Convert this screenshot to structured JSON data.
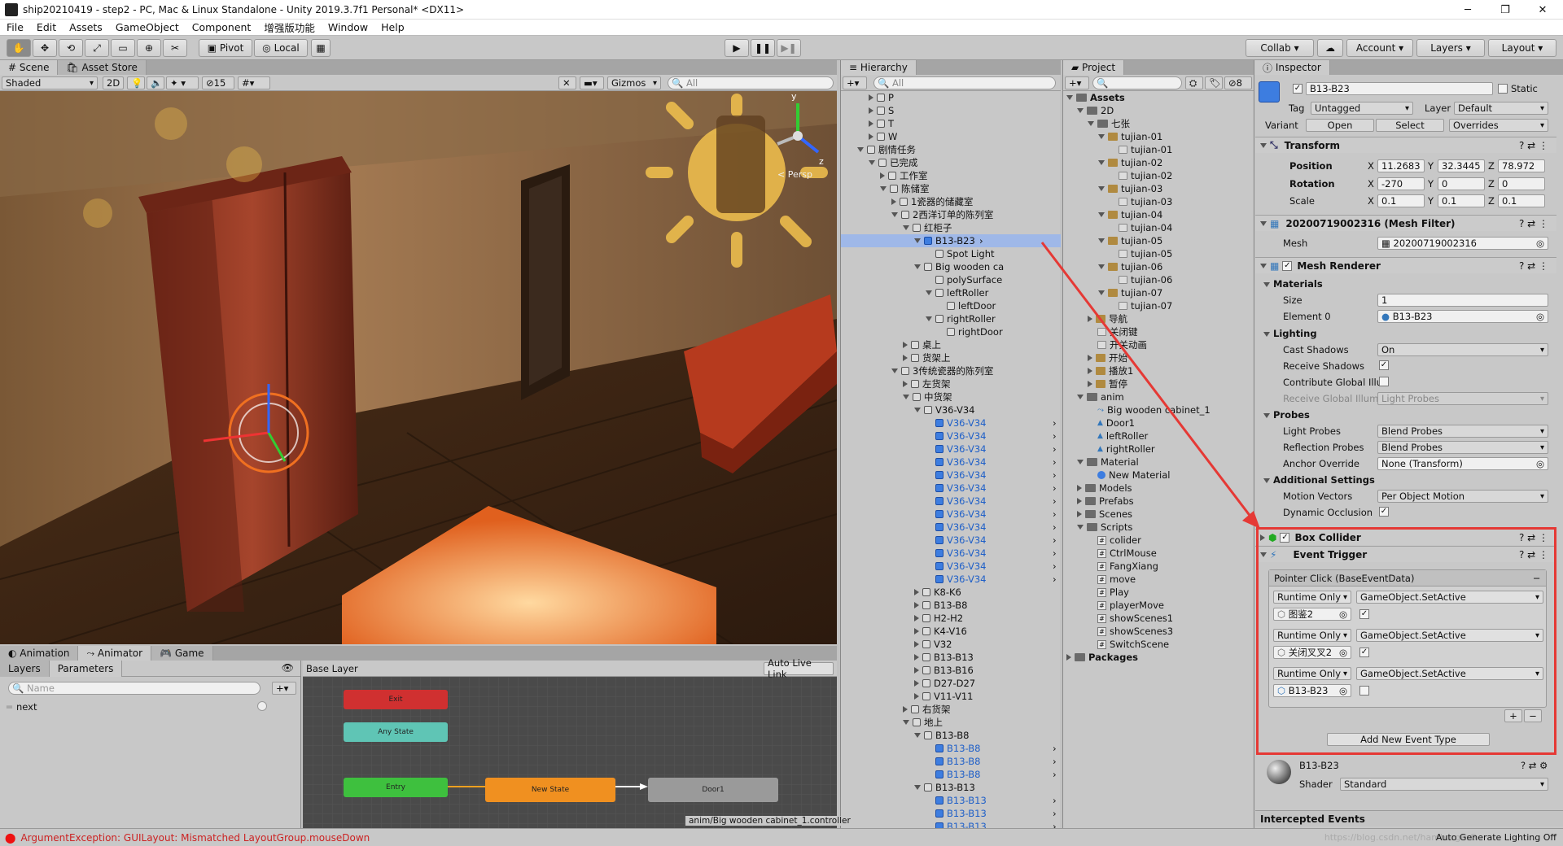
{
  "window": {
    "title": "ship20210419 - step2 - PC, Mac & Linux Standalone - Unity 2019.3.7f1 Personal* <DX11>"
  },
  "menu": [
    "File",
    "Edit",
    "Assets",
    "GameObject",
    "Component",
    "增强版功能",
    "Window",
    "Help"
  ],
  "toolbar": {
    "pivot": "Pivot",
    "local": "Local",
    "collab": "Collab",
    "account": "Account",
    "layers": "Layers",
    "layout": "Layout"
  },
  "scene": {
    "tab_scene": "Scene",
    "tab_store": "Asset Store",
    "shaded": "Shaded",
    "mode2d": "2D",
    "vis_count": "15",
    "gizmos": "Gizmos",
    "search": "All",
    "persp": "< Persp"
  },
  "hierarchy": {
    "tab": "Hierarchy",
    "search": "All",
    "items": [
      {
        "t": "P",
        "d": 6,
        "k": "r",
        "c": "g"
      },
      {
        "t": "S",
        "d": 6,
        "k": "r",
        "c": "g"
      },
      {
        "t": "T",
        "d": 6,
        "k": "r",
        "c": "g"
      },
      {
        "t": "W",
        "d": 6,
        "k": "r",
        "c": "g"
      },
      {
        "t": "剧情任务",
        "d": 5,
        "k": "d",
        "c": "g"
      },
      {
        "t": "已完成",
        "d": 6,
        "k": "d",
        "c": "g"
      },
      {
        "t": "工作室",
        "d": 7,
        "k": "r",
        "c": "g"
      },
      {
        "t": "陈储室",
        "d": 7,
        "k": "d",
        "c": "g"
      },
      {
        "t": "1瓷器的储藏室",
        "d": 8,
        "k": "r",
        "c": "g"
      },
      {
        "t": "2西洋订单的陈列室",
        "d": 8,
        "k": "d",
        "c": "g"
      },
      {
        "t": "红柜子",
        "d": 9,
        "k": "d",
        "c": "g"
      },
      {
        "t": "B13-B23",
        "d": 10,
        "k": "d",
        "c": "b",
        "sel": true
      },
      {
        "t": "Spot Light",
        "d": 11,
        "k": "n",
        "c": "g"
      },
      {
        "t": "Big wooden ca",
        "d": 10,
        "k": "d",
        "c": "g"
      },
      {
        "t": "polySurface",
        "d": 11,
        "k": "n",
        "c": "g"
      },
      {
        "t": "leftRoller",
        "d": 11,
        "k": "d",
        "c": "g"
      },
      {
        "t": "leftDoor",
        "d": 12,
        "k": "n",
        "c": "g"
      },
      {
        "t": "rightRoller",
        "d": 11,
        "k": "d",
        "c": "g"
      },
      {
        "t": "rightDoor",
        "d": 12,
        "k": "n",
        "c": "g"
      },
      {
        "t": "桌上",
        "d": 9,
        "k": "r",
        "c": "g"
      },
      {
        "t": "货架上",
        "d": 9,
        "k": "r",
        "c": "g"
      },
      {
        "t": "3传统瓷器的陈列室",
        "d": 8,
        "k": "d",
        "c": "g"
      },
      {
        "t": "左货架",
        "d": 9,
        "k": "r",
        "c": "g"
      },
      {
        "t": "中货架",
        "d": 9,
        "k": "d",
        "c": "g"
      },
      {
        "t": "V36-V34",
        "d": 10,
        "k": "d",
        "c": "g"
      },
      {
        "t": "V36-V34",
        "d": 11,
        "k": "n",
        "c": "b",
        "blue": true
      },
      {
        "t": "V36-V34",
        "d": 11,
        "k": "n",
        "c": "b",
        "blue": true
      },
      {
        "t": "V36-V34",
        "d": 11,
        "k": "n",
        "c": "b",
        "blue": true
      },
      {
        "t": "V36-V34",
        "d": 11,
        "k": "n",
        "c": "b",
        "blue": true
      },
      {
        "t": "V36-V34",
        "d": 11,
        "k": "n",
        "c": "b",
        "blue": true
      },
      {
        "t": "V36-V34",
        "d": 11,
        "k": "n",
        "c": "b",
        "blue": true
      },
      {
        "t": "V36-V34",
        "d": 11,
        "k": "n",
        "c": "b",
        "blue": true
      },
      {
        "t": "V36-V34",
        "d": 11,
        "k": "n",
        "c": "b",
        "blue": true
      },
      {
        "t": "V36-V34",
        "d": 11,
        "k": "n",
        "c": "b",
        "blue": true
      },
      {
        "t": "V36-V34",
        "d": 11,
        "k": "n",
        "c": "b",
        "blue": true
      },
      {
        "t": "V36-V34",
        "d": 11,
        "k": "n",
        "c": "b",
        "blue": true
      },
      {
        "t": "V36-V34",
        "d": 11,
        "k": "n",
        "c": "b",
        "blue": true
      },
      {
        "t": "V36-V34",
        "d": 11,
        "k": "n",
        "c": "b",
        "blue": true
      },
      {
        "t": "K8-K6",
        "d": 10,
        "k": "r",
        "c": "g"
      },
      {
        "t": "B13-B8",
        "d": 10,
        "k": "r",
        "c": "g"
      },
      {
        "t": "H2-H2",
        "d": 10,
        "k": "r",
        "c": "g"
      },
      {
        "t": "K4-V16",
        "d": 10,
        "k": "r",
        "c": "g"
      },
      {
        "t": "V32",
        "d": 10,
        "k": "r",
        "c": "g"
      },
      {
        "t": "B13-B13",
        "d": 10,
        "k": "r",
        "c": "g"
      },
      {
        "t": "B13-B16",
        "d": 10,
        "k": "r",
        "c": "g"
      },
      {
        "t": "D27-D27",
        "d": 10,
        "k": "r",
        "c": "g"
      },
      {
        "t": "V11-V11",
        "d": 10,
        "k": "r",
        "c": "g"
      },
      {
        "t": "右货架",
        "d": 9,
        "k": "r",
        "c": "g"
      },
      {
        "t": "地上",
        "d": 9,
        "k": "d",
        "c": "g"
      },
      {
        "t": "B13-B8",
        "d": 10,
        "k": "d",
        "c": "g"
      },
      {
        "t": "B13-B8",
        "d": 11,
        "k": "n",
        "c": "b",
        "blue": true
      },
      {
        "t": "B13-B8",
        "d": 11,
        "k": "n",
        "c": "b",
        "blue": true
      },
      {
        "t": "B13-B8",
        "d": 11,
        "k": "n",
        "c": "b",
        "blue": true
      },
      {
        "t": "B13-B13",
        "d": 10,
        "k": "d",
        "c": "g"
      },
      {
        "t": "B13-B13",
        "d": 11,
        "k": "n",
        "c": "b",
        "blue": true
      },
      {
        "t": "B13-B13",
        "d": 11,
        "k": "n",
        "c": "b",
        "blue": true
      },
      {
        "t": "B13-B13",
        "d": 11,
        "k": "n",
        "c": "b",
        "blue": true
      }
    ]
  },
  "project": {
    "tab": "Project",
    "count": "8",
    "items": [
      {
        "t": "Assets",
        "d": 0,
        "k": "d",
        "i": "f",
        "bold": true
      },
      {
        "t": "2D",
        "d": 1,
        "k": "d",
        "i": "f"
      },
      {
        "t": "七张",
        "d": 2,
        "k": "d",
        "i": "f"
      },
      {
        "t": "tujian-01",
        "d": 3,
        "k": "d",
        "i": "img"
      },
      {
        "t": "tujian-01",
        "d": 4,
        "k": "n",
        "i": "sp"
      },
      {
        "t": "tujian-02",
        "d": 3,
        "k": "d",
        "i": "img"
      },
      {
        "t": "tujian-02",
        "d": 4,
        "k": "n",
        "i": "sp"
      },
      {
        "t": "tujian-03",
        "d": 3,
        "k": "d",
        "i": "img"
      },
      {
        "t": "tujian-03",
        "d": 4,
        "k": "n",
        "i": "sp"
      },
      {
        "t": "tujian-04",
        "d": 3,
        "k": "d",
        "i": "img"
      },
      {
        "t": "tujian-04",
        "d": 4,
        "k": "n",
        "i": "sp"
      },
      {
        "t": "tujian-05",
        "d": 3,
        "k": "d",
        "i": "img"
      },
      {
        "t": "tujian-05",
        "d": 4,
        "k": "n",
        "i": "sp"
      },
      {
        "t": "tujian-06",
        "d": 3,
        "k": "d",
        "i": "img"
      },
      {
        "t": "tujian-06",
        "d": 4,
        "k": "n",
        "i": "sp"
      },
      {
        "t": "tujian-07",
        "d": 3,
        "k": "d",
        "i": "img"
      },
      {
        "t": "tujian-07",
        "d": 4,
        "k": "n",
        "i": "sp"
      },
      {
        "t": "导航",
        "d": 2,
        "k": "r",
        "i": "img"
      },
      {
        "t": "关闭键",
        "d": 2,
        "k": "n",
        "i": "sp"
      },
      {
        "t": "开关动画",
        "d": 2,
        "k": "n",
        "i": "sp"
      },
      {
        "t": "开始",
        "d": 2,
        "k": "r",
        "i": "img"
      },
      {
        "t": "播放1",
        "d": 2,
        "k": "r",
        "i": "img"
      },
      {
        "t": "暂停",
        "d": 2,
        "k": "r",
        "i": "img"
      },
      {
        "t": "anim",
        "d": 1,
        "k": "d",
        "i": "f"
      },
      {
        "t": "Big wooden cabinet_1",
        "d": 2,
        "k": "n",
        "i": "ctl"
      },
      {
        "t": "Door1",
        "d": 2,
        "k": "n",
        "i": "anim"
      },
      {
        "t": "leftRoller",
        "d": 2,
        "k": "n",
        "i": "anim"
      },
      {
        "t": "rightRoller",
        "d": 2,
        "k": "n",
        "i": "anim"
      },
      {
        "t": "Material",
        "d": 1,
        "k": "d",
        "i": "f"
      },
      {
        "t": "New Material",
        "d": 2,
        "k": "n",
        "i": "mat"
      },
      {
        "t": "Models",
        "d": 1,
        "k": "r",
        "i": "f"
      },
      {
        "t": "Prefabs",
        "d": 1,
        "k": "r",
        "i": "f"
      },
      {
        "t": "Scenes",
        "d": 1,
        "k": "r",
        "i": "f"
      },
      {
        "t": "Scripts",
        "d": 1,
        "k": "d",
        "i": "f"
      },
      {
        "t": "colider",
        "d": 2,
        "k": "n",
        "i": "cs"
      },
      {
        "t": "CtrlMouse",
        "d": 2,
        "k": "n",
        "i": "cs"
      },
      {
        "t": "FangXiang",
        "d": 2,
        "k": "n",
        "i": "cs"
      },
      {
        "t": "move",
        "d": 2,
        "k": "n",
        "i": "cs"
      },
      {
        "t": "Play",
        "d": 2,
        "k": "n",
        "i": "cs"
      },
      {
        "t": "playerMove",
        "d": 2,
        "k": "n",
        "i": "cs"
      },
      {
        "t": "showScenes1",
        "d": 2,
        "k": "n",
        "i": "cs"
      },
      {
        "t": "showScenes3",
        "d": 2,
        "k": "n",
        "i": "cs"
      },
      {
        "t": "SwitchScene",
        "d": 2,
        "k": "n",
        "i": "cs"
      },
      {
        "t": "Packages",
        "d": 0,
        "k": "r",
        "i": "f",
        "bold": true
      }
    ]
  },
  "inspector": {
    "tab": "Inspector",
    "name": "B13-B23",
    "static": "Static",
    "tag_label": "Tag",
    "tag": "Untagged",
    "layer_label": "Layer",
    "layer": "Default",
    "variant": "Variant",
    "open": "Open",
    "select": "Select",
    "overrides": "Overrides",
    "transform": "Transform",
    "position": "Position",
    "rotation": "Rotation",
    "scale": "Scale",
    "pos": [
      "11.2683",
      "32.3445",
      "78.972"
    ],
    "rot": [
      "-270",
      "0",
      "0"
    ],
    "scl": [
      "0.1",
      "0.1",
      "0.1"
    ],
    "axis": [
      "X",
      "Y",
      "Z"
    ],
    "meshfilter": "20200719002316 (Mesh Filter)",
    "mesh_label": "Mesh",
    "mesh": "20200719002316",
    "meshrenderer": "Mesh Renderer",
    "materials": "Materials",
    "size_label": "Size",
    "size": "1",
    "element0_label": "Element 0",
    "element0": "B13-B23",
    "lighting": "Lighting",
    "cast_label": "Cast Shadows",
    "cast": "On",
    "receive_label": "Receive Shadows",
    "contrib_label": "Contribute Global Illu",
    "recvgi_label": "Receive Global Illum",
    "recvgi": "Light Probes",
    "probes": "Probes",
    "lightprobes_label": "Light Probes",
    "lightprobes": "Blend Probes",
    "reflprobes_label": "Reflection Probes",
    "reflprobes": "Blend Probes",
    "anchor_label": "Anchor Override",
    "anchor": "None (Transform)",
    "additional": "Additional Settings",
    "motion_label": "Motion Vectors",
    "motion": "Per Object Motion",
    "dynocc_label": "Dynamic Occlusion",
    "boxcollider": "Box Collider",
    "eventtrigger": "Event Trigger",
    "pointerclick": "Pointer Click (BaseEventData)",
    "entries": [
      {
        "mode": "Runtime Only",
        "func": "GameObject.SetActive",
        "obj": "图鉴2",
        "checked": "✓"
      },
      {
        "mode": "Runtime Only",
        "func": "GameObject.SetActive",
        "obj": "关闭叉叉2",
        "checked": "✓"
      },
      {
        "mode": "Runtime Only",
        "func": "GameObject.SetActive",
        "obj": "B13-B23",
        "checked": ""
      }
    ],
    "add_event": "Add New Event Type",
    "material_name": "B13-B23",
    "shader_label": "Shader",
    "shader": "Standard",
    "intercepted": "Intercepted Events",
    "autolight": "Auto Generate Lighting Off"
  },
  "bottom": {
    "tab_animation": "Animation",
    "tab_animator": "Animator",
    "tab_game": "Game",
    "layers": "Layers",
    "parameters": "Parameters",
    "name_placeholder": "Name",
    "param": "next",
    "base_layer": "Base Layer",
    "autolive": "Auto Live Link",
    "nodes": {
      "exit": "Exit",
      "any": "Any State",
      "entry": "Entry",
      "newstate": "New State",
      "door": "Door1"
    },
    "controller_path": "anim/Big wooden cabinet_1.controller"
  },
  "status": {
    "error": "ArgumentException: GUILayout: Mismatched LayoutGroup.mouseDown",
    "watermark": "https://blog.csdn.net/hamburgerG"
  }
}
